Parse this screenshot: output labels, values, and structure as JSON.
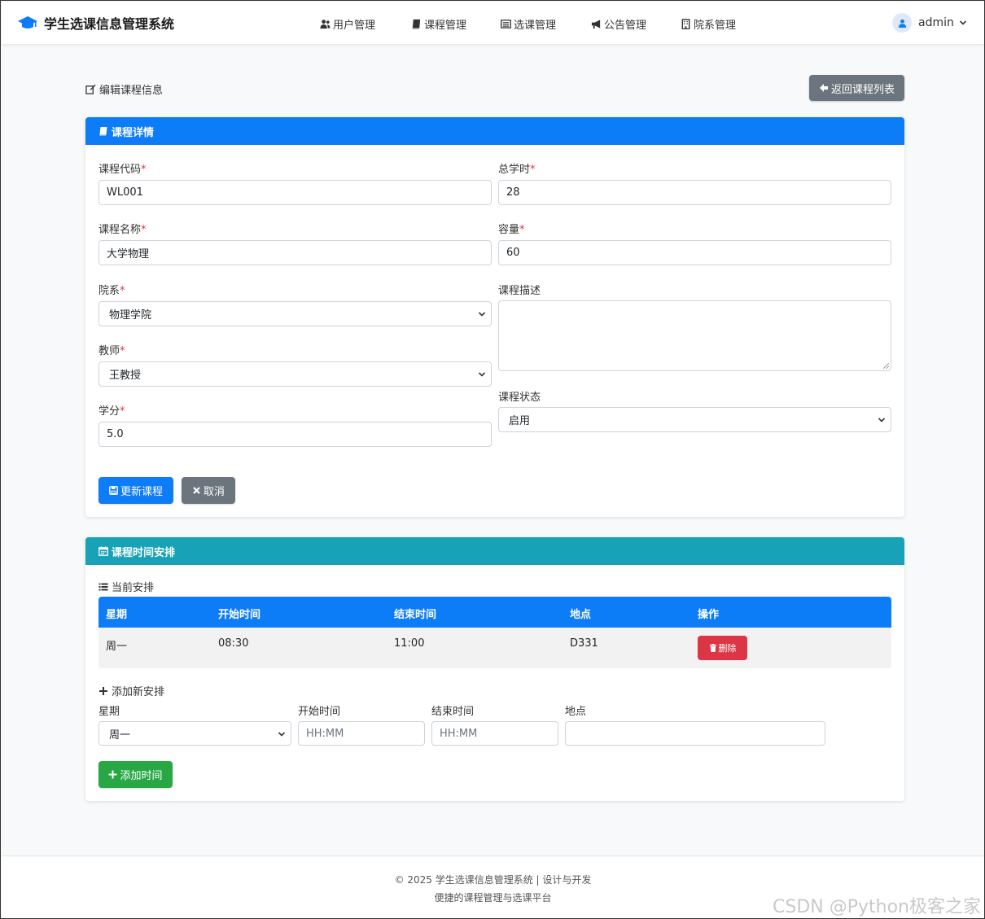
{
  "app": {
    "title": "学生选课信息管理系统"
  },
  "nav": {
    "items": [
      {
        "label": "用户管理",
        "icon": "users-icon"
      },
      {
        "label": "课程管理",
        "icon": "book-icon"
      },
      {
        "label": "选课管理",
        "icon": "list-alt-icon"
      },
      {
        "label": "公告管理",
        "icon": "bullhorn-icon"
      },
      {
        "label": "院系管理",
        "icon": "building-icon"
      }
    ],
    "user": "admin"
  },
  "page": {
    "title": "编辑课程信息",
    "back_label": "返回课程列表"
  },
  "course_card": {
    "title": "课程详情",
    "required_mark": "*",
    "fields": {
      "code": {
        "label": "课程代码",
        "value": "WL001"
      },
      "hours": {
        "label": "总学时",
        "value": "28"
      },
      "name": {
        "label": "课程名称",
        "value": "大学物理"
      },
      "capacity": {
        "label": "容量",
        "value": "60"
      },
      "department": {
        "label": "院系",
        "value": "物理学院"
      },
      "description": {
        "label": "课程描述",
        "value": ""
      },
      "teacher": {
        "label": "教师",
        "value": "王教授"
      },
      "status": {
        "label": "课程状态",
        "value": "启用"
      },
      "credit": {
        "label": "学分",
        "value": "5.0"
      }
    },
    "update_label": "更新课程",
    "cancel_label": "取消"
  },
  "schedule_card": {
    "title": "课程时间安排",
    "current_title": "当前安排",
    "columns": [
      "星期",
      "开始时间",
      "结束时间",
      "地点",
      "操作"
    ],
    "rows": [
      {
        "day": "周一",
        "start": "08:30",
        "end": "11:00",
        "location": "D331",
        "action": "删除"
      }
    ],
    "add_title": "添加新安排",
    "add_form": {
      "day_label": "星期",
      "day_value": "周一",
      "start_label": "开始时间",
      "start_placeholder": "HH:MM",
      "end_label": "结束时间",
      "end_placeholder": "HH:MM",
      "location_label": "地点",
      "location_value": ""
    },
    "add_label": "添加时间"
  },
  "footer": {
    "line1": "© 2025 学生选课信息管理系统 | 设计与开发",
    "line2": "便捷的课程管理与选课平台"
  },
  "watermark": "CSDN @Python极客之家",
  "colors": {
    "primary": "#0d7cf7",
    "info": "#17a2b8",
    "secondary": "#6c757d",
    "success": "#28a745",
    "danger": "#dc3545"
  }
}
